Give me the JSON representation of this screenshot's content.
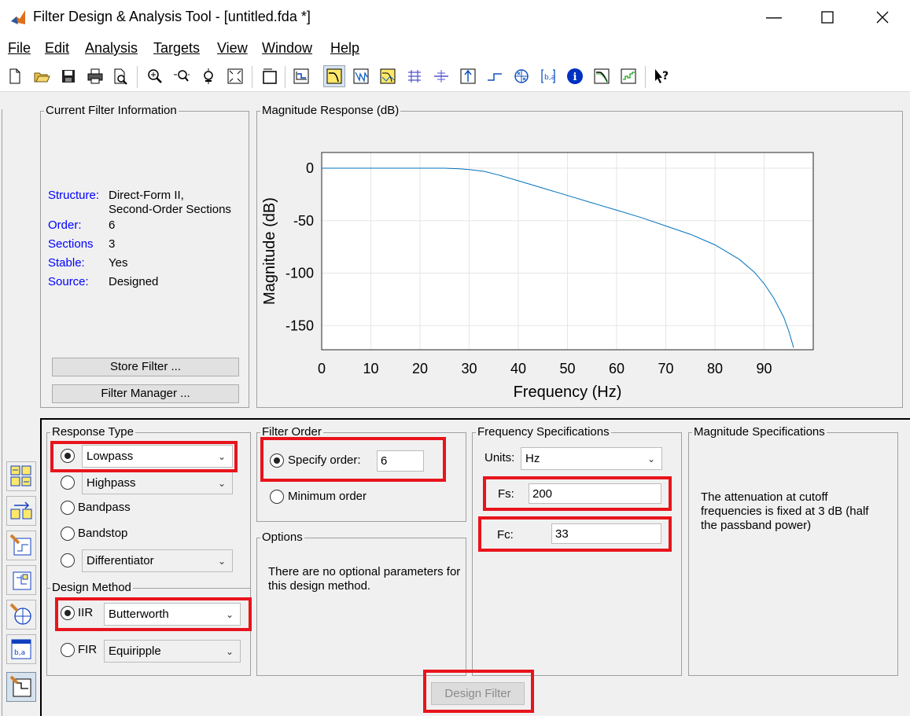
{
  "window": {
    "title": "Filter Design & Analysis Tool -  [untitled.fda *]"
  },
  "menu": [
    "File",
    "Edit",
    "Analysis",
    "Targets",
    "View",
    "Window",
    "Help"
  ],
  "current_filter": {
    "legend": "Current Filter Information",
    "rows": [
      {
        "label": "Structure:",
        "value": "Direct-Form II,"
      },
      {
        "label": "",
        "value": "Second-Order Sections"
      },
      {
        "label": "Order:",
        "value": "6"
      },
      {
        "label": "Sections",
        "value": "3"
      },
      {
        "label": "Stable:",
        "value": "Yes"
      },
      {
        "label": "Source:",
        "value": "Designed"
      }
    ],
    "store_button": "Store Filter ...",
    "manager_button": "Filter Manager ..."
  },
  "magnitude_panel": {
    "legend": "Magnitude Response (dB)"
  },
  "chart_data": {
    "type": "line",
    "xlabel": "Frequency (Hz)",
    "ylabel": "Magnitude (dB)",
    "xlim": [
      0,
      100
    ],
    "ylim": [
      -173,
      15
    ],
    "xticks": [
      "0",
      "10",
      "20",
      "30",
      "40",
      "50",
      "60",
      "70",
      "80",
      "90"
    ],
    "yticks": [
      "0",
      "-50",
      "-100",
      "-150"
    ],
    "grid": true,
    "line_color": "#0072bd",
    "series": [
      {
        "x": [
          0,
          10,
          20,
          25,
          28,
          30,
          33,
          36,
          40,
          45,
          50,
          55,
          60,
          65,
          70,
          75,
          80,
          85,
          88,
          90,
          92,
          94,
          95,
          96
        ],
        "y": [
          0,
          0,
          0,
          0,
          -0.6,
          -1.3,
          -3,
          -6.5,
          -12,
          -19,
          -26,
          -33,
          -40,
          -47,
          -55,
          -63,
          -73,
          -87,
          -99,
          -110,
          -124,
          -142,
          -155,
          -171
        ]
      }
    ]
  },
  "response_type": {
    "legend": "Response Type",
    "options": [
      {
        "label": "Lowpass",
        "selected": true,
        "combo": true
      },
      {
        "label": "Highpass",
        "selected": false,
        "combo": true
      },
      {
        "label": "Bandpass",
        "selected": false,
        "combo": false
      },
      {
        "label": "Bandstop",
        "selected": false,
        "combo": false
      },
      {
        "label": "Differentiator",
        "selected": false,
        "combo": true
      }
    ]
  },
  "design_method": {
    "legend": "Design Method",
    "iir_label": "IIR",
    "iir_value": "Butterworth",
    "fir_label": "FIR",
    "fir_value": "Equiripple"
  },
  "filter_order": {
    "legend": "Filter Order",
    "specify_label": "Specify order:",
    "specify_value": "6",
    "minimum_label": "Minimum order"
  },
  "options": {
    "legend": "Options",
    "text": "There are no optional parameters for this design method."
  },
  "frequency_specs": {
    "legend": "Frequency Specifications",
    "units_label": "Units:",
    "units_value": "Hz",
    "fs_label": "Fs:",
    "fs_value": "200",
    "fc_label": "Fc:",
    "fc_value": "33"
  },
  "magnitude_specs": {
    "legend": "Magnitude Specifications",
    "text": "The attenuation at cutoff frequencies is fixed at 3 dB (half the passband power)"
  },
  "design_button": "Design Filter",
  "colors": {
    "highlight": "#e8141c",
    "label_blue": "#0000ff",
    "plot_line": "#0072bd",
    "panel_bg": "#f0f0f0"
  }
}
